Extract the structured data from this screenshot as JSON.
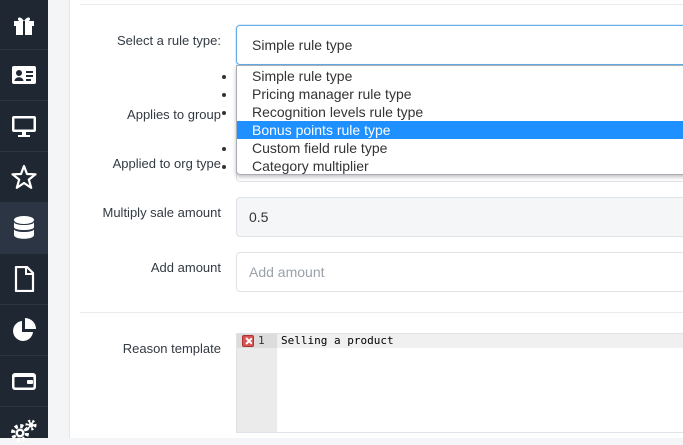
{
  "sidebar": {
    "items": [
      {
        "icon": "gift-icon"
      },
      {
        "icon": "id-card-icon"
      },
      {
        "icon": "monitor-icon"
      },
      {
        "icon": "star-icon"
      },
      {
        "icon": "database-icon"
      },
      {
        "icon": "file-icon"
      },
      {
        "icon": "pie-chart-icon"
      },
      {
        "icon": "wallet-icon"
      },
      {
        "icon": "cogs-icon"
      }
    ],
    "active_index": 4
  },
  "form": {
    "rule_type": {
      "label": "Select a rule type:",
      "value": "Simple rule type",
      "options": [
        "Simple rule type",
        "Pricing manager rule type",
        "Recognition levels rule type",
        "Bonus points rule type",
        "Custom field rule type",
        "Category multiplier"
      ],
      "highlighted": "Bonus points rule type"
    },
    "applies_to_group": {
      "label": "Applies to group"
    },
    "applied_to_org_type": {
      "label": "Applied to org type"
    },
    "multiply_sale_amount": {
      "label": "Multiply sale amount",
      "value": "0.5"
    },
    "add_amount": {
      "label": "Add amount",
      "placeholder": "Add amount",
      "value": ""
    },
    "reason_template": {
      "label": "Reason template",
      "line_number": "1",
      "code": "Selling a product"
    }
  },
  "colors": {
    "sidebar_bg": "#1f2733",
    "highlight": "#1e90ff",
    "focus_border": "#66afe9",
    "error": "#d9534f"
  }
}
